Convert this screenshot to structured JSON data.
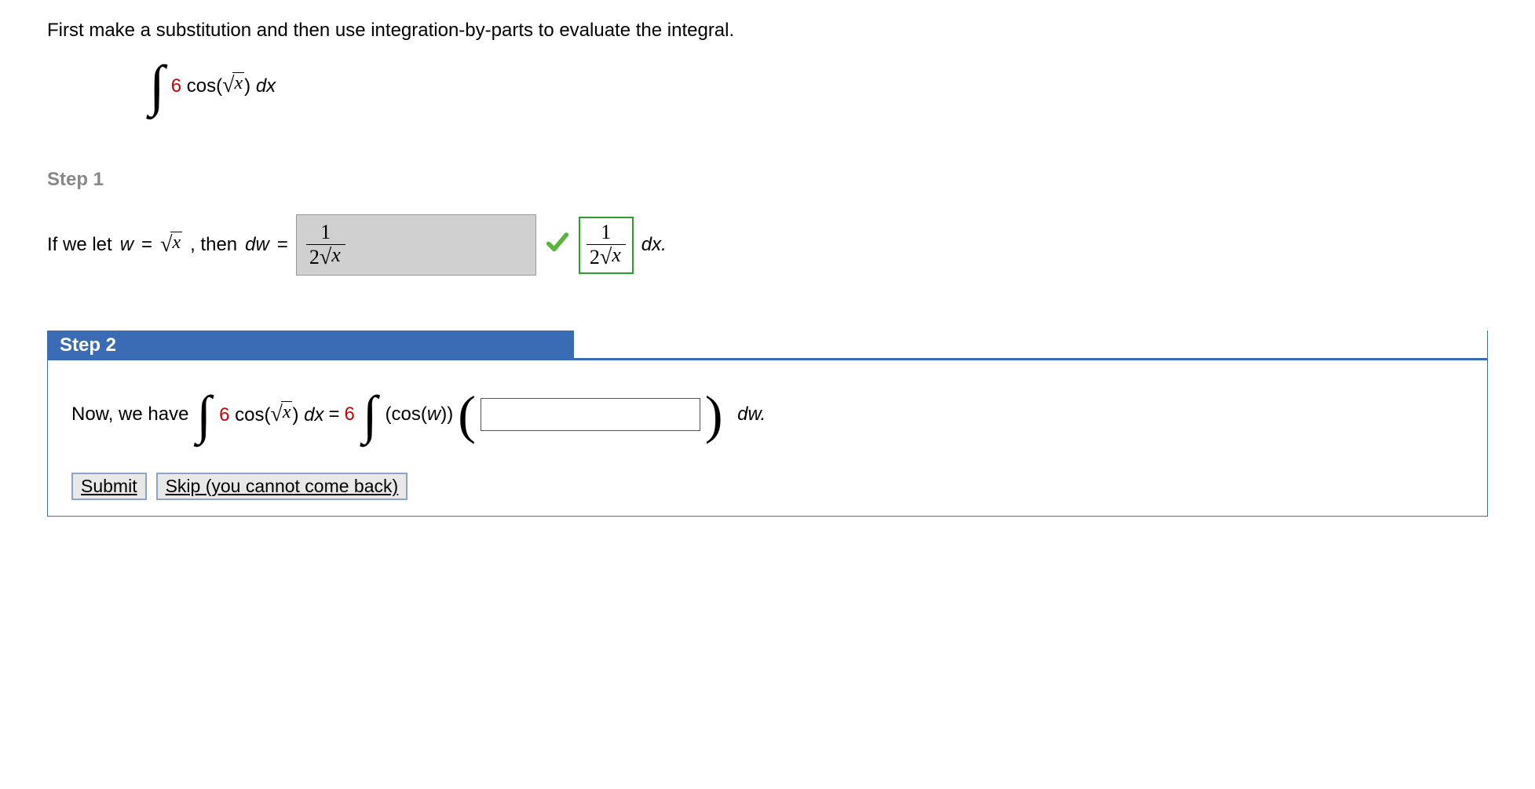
{
  "problem": {
    "statement": "First make a substitution and then use integration-by-parts to evaluate the integral.",
    "coefficient": "6",
    "integrand_after_coef": " cos(",
    "sqrt_arg": "x",
    "integrand_close": ") ",
    "dx": "dx"
  },
  "step1": {
    "header": "Step 1",
    "text_prefix": "If we let  ",
    "w_eq": "w",
    "equals": " = ",
    "sqrt_arg": "x",
    "comma_then": ",  then  ",
    "dw_eq": "dw",
    "equals2": " = ",
    "answer_num": "1",
    "answer_den_coef": "2",
    "answer_den_sqrt": "x",
    "correct_num": "1",
    "correct_den_coef": "2",
    "correct_den_sqrt": "x",
    "dx_period": "dx."
  },
  "step2": {
    "header": "Step 2",
    "text_prefix": "Now, we have   ",
    "coef1": "6",
    "cos_open": " cos(",
    "sqrt_arg": "x",
    "close_dx_eq": ") ",
    "dx": "dx",
    "equals": " = ",
    "coef2": "6",
    "cosw": " (cos(",
    "w": "w",
    "cosw_close": ")) ",
    "dw_period": "dw.",
    "submit": "Submit",
    "skip": "Skip (you cannot come back)"
  }
}
